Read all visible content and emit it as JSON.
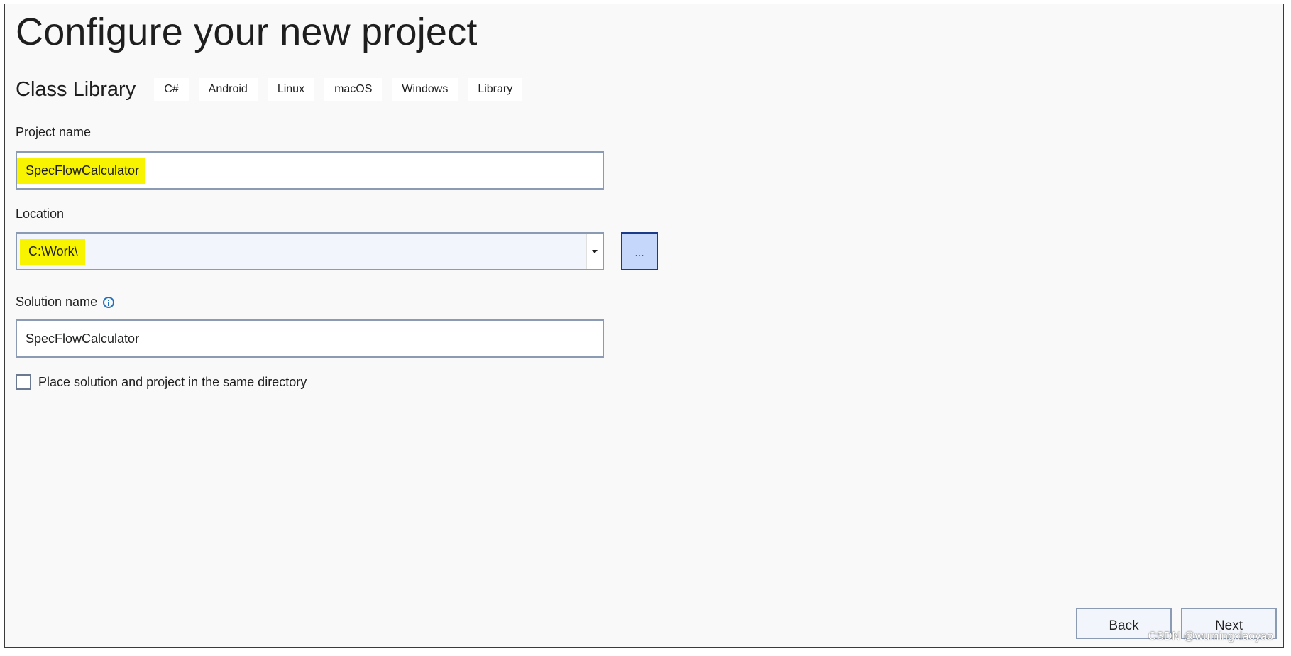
{
  "page": {
    "title": "Configure your new project"
  },
  "template": {
    "name": "Class Library",
    "tags": [
      "C#",
      "Android",
      "Linux",
      "macOS",
      "Windows",
      "Library"
    ]
  },
  "project_name": {
    "label": "Project name",
    "value": "SpecFlowCalculator"
  },
  "location": {
    "label": "Location",
    "value": "C:\\Work\\",
    "browse_label": "..."
  },
  "solution_name": {
    "label": "Solution name",
    "value": "SpecFlowCalculator"
  },
  "same_directory": {
    "label": "Place solution and project in the same directory",
    "checked": false
  },
  "footer": {
    "back_label": "Back",
    "next_label": "Next"
  },
  "watermark": "CSDN @wumingxiaoyao",
  "colors": {
    "highlight": "#f8f400",
    "browse_button": "#c5d7fa",
    "browse_border": "#1b3a8a",
    "info_icon": "#1f6fbf"
  },
  "icons": [
    "info-icon",
    "chevron-down-icon"
  ]
}
